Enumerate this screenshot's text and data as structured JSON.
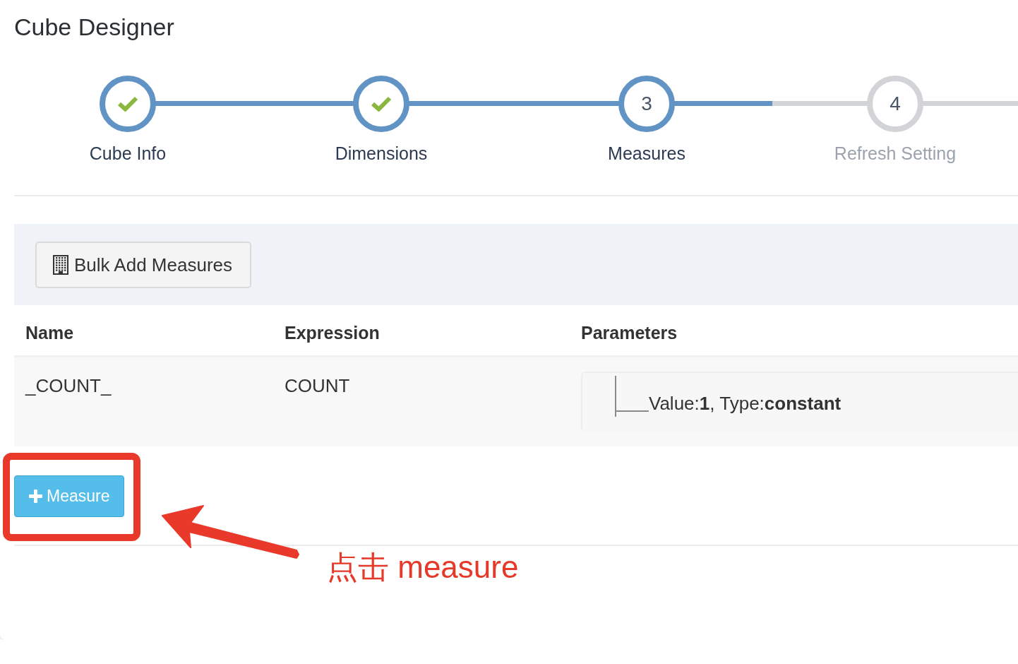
{
  "title": "Cube Designer",
  "steps": [
    {
      "label": "Cube Info",
      "completed": true,
      "selected": false
    },
    {
      "label": "Dimensions",
      "completed": true,
      "selected": false
    },
    {
      "label": "Measures",
      "completed": false,
      "selected": true,
      "number": "3"
    },
    {
      "label": "Refresh Setting",
      "completed": false,
      "selected": false,
      "number": "4"
    }
  ],
  "toolbar": {
    "bulk_add_button": "Bulk Add Measures"
  },
  "table": {
    "columns": [
      "Name",
      "Expression",
      "Parameters"
    ],
    "rows": [
      {
        "name": "_COUNT_",
        "expression": "COUNT",
        "parameters": [
          "Value:**1**, Type:**constant**"
        ]
      }
    ]
  },
  "add_button": {
    "label": "Measure"
  },
  "annotation": {
    "text": "点击 measure"
  }
}
